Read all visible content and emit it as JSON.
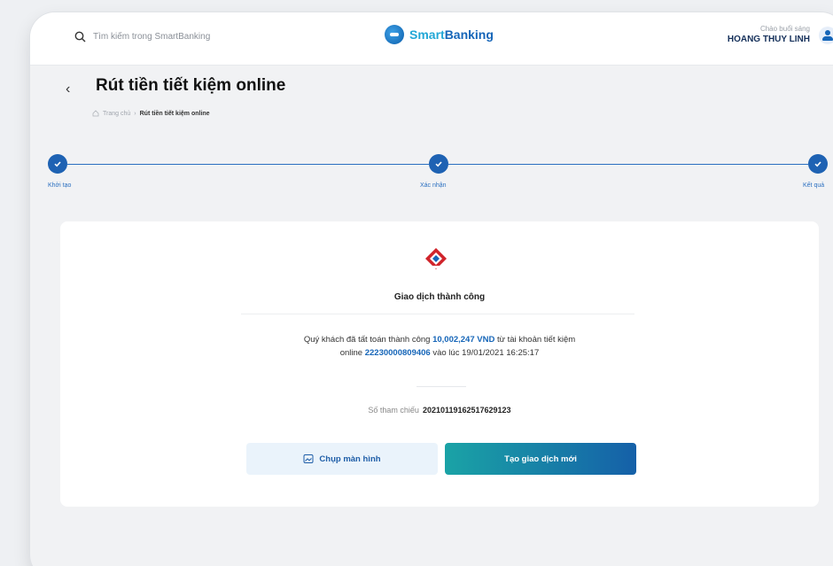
{
  "header": {
    "search_placeholder": "Tìm kiếm trong SmartBanking",
    "logo_brand_a": "Smart",
    "logo_brand_b": "Banking",
    "greeting": "Chào buổi sáng",
    "user_name": "HOANG THUY LINH"
  },
  "page": {
    "title": "Rút tiền tiết kiệm online",
    "breadcrumb_home": "Trang chủ",
    "breadcrumb_separator": "›",
    "breadcrumb_current": "Rút tiền tiết kiệm online"
  },
  "steps": [
    {
      "label": "Khởi tạo"
    },
    {
      "label": "Xác nhận"
    },
    {
      "label": "Kết quả"
    }
  ],
  "result": {
    "status": "Giao dịch thành công",
    "msg_part1": "Quý khách đã tất toán thành công ",
    "amount": "10,002,247 VND",
    "msg_part2": " từ tài khoản tiết kiệm",
    "msg_part3": "online ",
    "account": "22230000809406",
    "msg_part4": " vào lúc 19/01/2021 16:25:17",
    "ref_label": "Số tham chiếu",
    "ref_value": "20210119162517629123"
  },
  "actions": {
    "screenshot_label": "Chụp màn hình",
    "new_transaction_label": "Tạo giao dịch mới"
  },
  "colors": {
    "primary": "#1565b8",
    "accent": "#1aa3a6",
    "bank_logo": "#d0242b"
  }
}
